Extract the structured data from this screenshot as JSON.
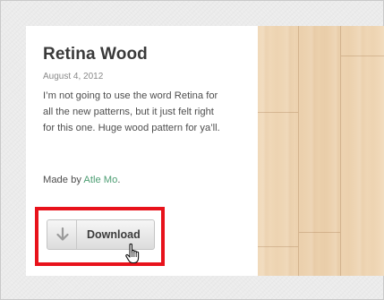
{
  "post": {
    "title": "Retina Wood",
    "date": "August 4, 2012",
    "description": "I’m not going to use the word Retina for all the new patterns, but it just felt right for this one. Huge wood pattern for ya’ll.",
    "credit_prefix": "Made by",
    "author": "Atle Mo",
    "credit_suffix": "."
  },
  "download": {
    "label": "Download",
    "icon": "download-arrow-icon"
  },
  "annotation": {
    "highlight_color": "#e8121b",
    "cursor": "hand-pointer-icon"
  },
  "colors": {
    "link": "#4d9e73",
    "wood": "#efd5b2",
    "page_background": "#ebebeb"
  }
}
